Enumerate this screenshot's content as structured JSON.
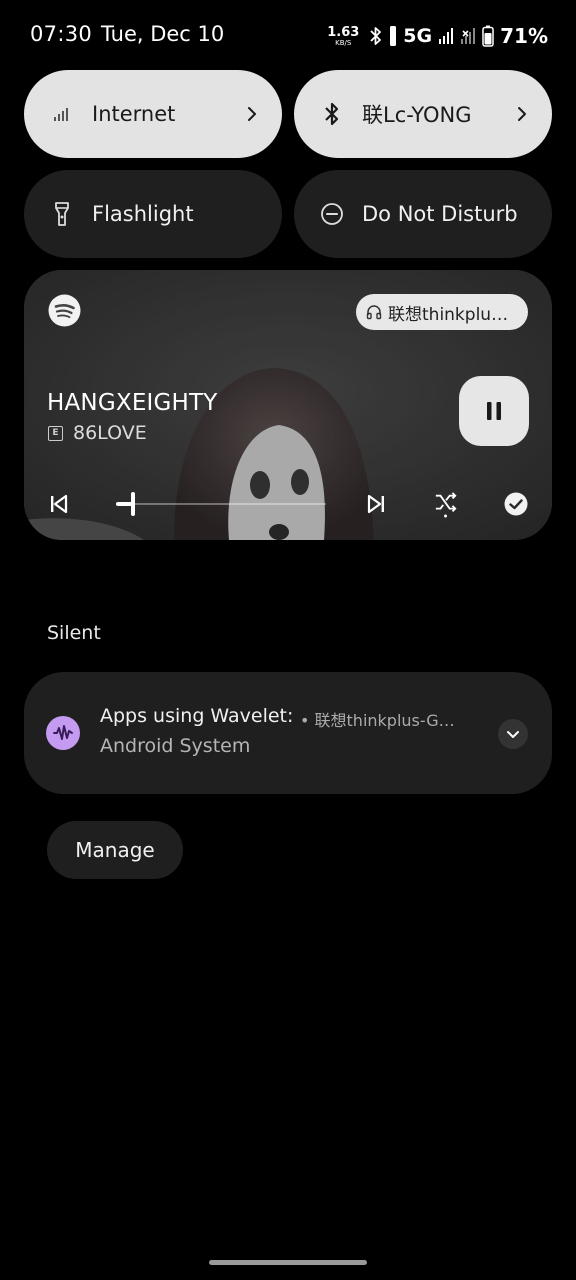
{
  "status_bar": {
    "time": "07:30",
    "date": "Tue, Dec 10",
    "net_speed_value": "1.63",
    "net_speed_unit": "KB/S",
    "network_type": "5G",
    "battery_percent": "71%",
    "icons": [
      "bluetooth-icon",
      "vibrate-icon",
      "signal-icon",
      "signal-no-data-icon",
      "battery-icon"
    ]
  },
  "quick_tiles": {
    "internet": {
      "label": "Internet",
      "state": "on"
    },
    "bluetooth": {
      "label": "联Lc-YONG",
      "state": "on"
    },
    "flashlight": {
      "label": "Flashlight",
      "state": "off"
    },
    "dnd": {
      "label": "Do Not Disturb",
      "state": "off"
    }
  },
  "media": {
    "app": "spotify",
    "device_chip": "联想thinkplu…",
    "title": "HANGXEIGHTY",
    "explicit_badge": "E",
    "artist": "86LOVE",
    "progress_fraction": 0.08,
    "playing": true
  },
  "notifications": {
    "section_label": "Silent",
    "items": [
      {
        "title": "Apps using Wavelet:",
        "meta": "• 联想thinkplus-G…",
        "subtitle": "Android System"
      }
    ],
    "manage_label": "Manage"
  },
  "colors": {
    "tile_active": "#e3e3e3",
    "tile_inactive": "#1f1f1f",
    "wavelet_icon": "#c49bf0",
    "background": "#000000"
  }
}
